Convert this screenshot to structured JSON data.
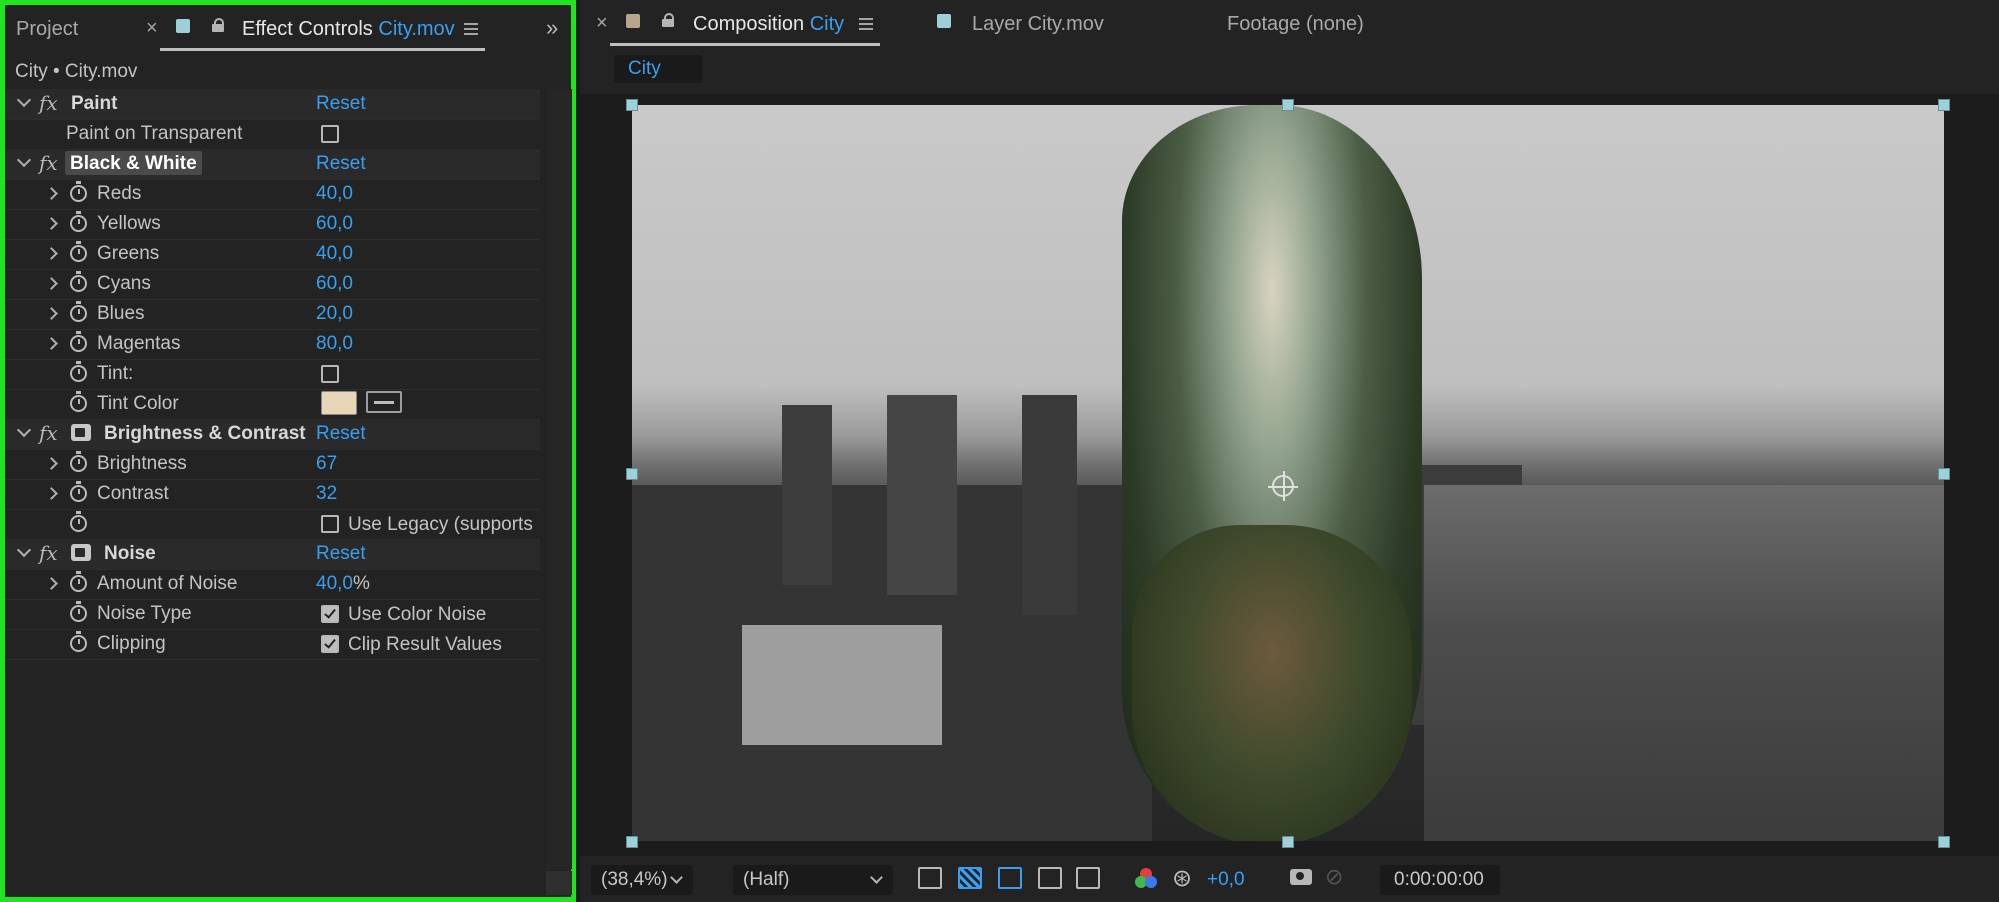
{
  "left_panel": {
    "tabs": {
      "project": "Project",
      "effect_controls": "Effect Controls",
      "effect_controls_target": "City.mov"
    },
    "layer_path": "City • City.mov",
    "effects": {
      "paint": {
        "name": "Paint",
        "reset": "Reset",
        "paint_on_transparent": "Paint on Transparent"
      },
      "black_white": {
        "name": "Black & White",
        "reset": "Reset",
        "reds": {
          "label": "Reds",
          "value": "40,0"
        },
        "yellows": {
          "label": "Yellows",
          "value": "60,0"
        },
        "greens": {
          "label": "Greens",
          "value": "40,0"
        },
        "cyans": {
          "label": "Cyans",
          "value": "60,0"
        },
        "blues": {
          "label": "Blues",
          "value": "20,0"
        },
        "magentas": {
          "label": "Magentas",
          "value": "80,0"
        },
        "tint": "Tint:",
        "tint_color": "Tint Color",
        "tint_color_hex": "#e7d6b8"
      },
      "brightness_contrast": {
        "name": "Brightness & Contrast",
        "reset": "Reset",
        "brightness": {
          "label": "Brightness",
          "value": "67"
        },
        "contrast": {
          "label": "Contrast",
          "value": "32"
        },
        "use_legacy": "Use Legacy (supports"
      },
      "noise": {
        "name": "Noise",
        "reset": "Reset",
        "amount": {
          "label": "Amount of Noise",
          "value": "40,0",
          "unit": "%"
        },
        "noise_type": {
          "label": "Noise Type",
          "option": "Use Color Noise"
        },
        "clipping": {
          "label": "Clipping",
          "option": "Clip Result Values"
        }
      }
    }
  },
  "right_panel": {
    "tabs": {
      "composition": "Composition",
      "composition_name": "City",
      "layer": "Layer City.mov",
      "footage": "Footage (none)"
    },
    "subtab": "City",
    "bottom": {
      "zoom": "(38,4%)",
      "resolution": "(Half)",
      "exposure": "+0,0",
      "timecode": "0:00:00:00"
    }
  },
  "colors": {
    "accent": "#3a9ff0",
    "highlight_border": "#1ee51e"
  }
}
